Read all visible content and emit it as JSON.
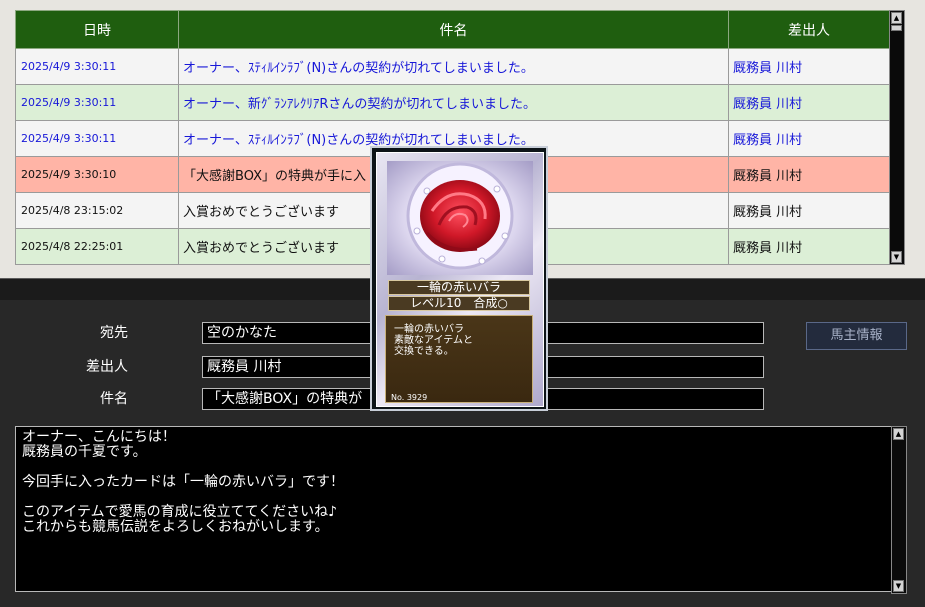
{
  "mail_list": {
    "headers": {
      "date": "日時",
      "subject": "件名",
      "sender": "差出人"
    },
    "rows": [
      {
        "date": "2025/4/9 3:30:11",
        "subject": "オーナー、ｽﾃｨﾙｲﾝﾗﾌﾞ(N)さんの契約が切れてしまいました。",
        "sender": "厩務員 川村"
      },
      {
        "date": "2025/4/9 3:30:11",
        "subject": "オーナー、新ｸﾞﾗﾝｱﾚｸﾘｱRさんの契約が切れてしまいました。",
        "sender": "厩務員 川村"
      },
      {
        "date": "2025/4/9 3:30:11",
        "subject": "オーナー、ｽﾃｨﾙｲﾝﾗﾌﾞ(N)さんの契約が切れてしまいました。",
        "sender": "厩務員 川村"
      },
      {
        "date": "2025/4/9 3:30:10",
        "subject": "「大感謝BOX」の特典が手に入",
        "sender": "厩務員 川村"
      },
      {
        "date": "2025/4/8 23:15:02",
        "subject": "入賞おめでとうございます",
        "sender": "厩務員 川村"
      },
      {
        "date": "2025/4/8 22:25:01",
        "subject": "入賞おめでとうございます",
        "sender": "厩務員 川村"
      }
    ]
  },
  "detail": {
    "to_label": "宛先",
    "to_value": "空のかなた",
    "from_label": "差出人",
    "from_value": "厩務員 川村",
    "subject_label": "件名",
    "subject_value": "「大感謝BOX」の特典が",
    "horse_info_button": "馬主情報",
    "body_lines": [
      "オーナー、こんにちは！",
      "厩務員の千夏です。",
      "",
      "今回手に入ったカードは「一輪の赤いバラ」です！",
      "",
      "このアイテムで愛馬の育成に役立ててくださいね♪",
      "これからも競馬伝説をよろしくおねがいします。"
    ]
  },
  "card": {
    "name": "一輪の赤いバラ",
    "level": "レベル10　合成○",
    "description_lines": [
      "一輪の赤いバラ",
      "素敵なアイテムと",
      "交換できる。"
    ],
    "number": "No. 3929"
  },
  "colors": {
    "header_green": "#1f5e0f",
    "unread_text": "#1717d8",
    "row_green": "#dcefd6",
    "row_red": "#ffb4a6",
    "rose_red": "#d01828"
  }
}
